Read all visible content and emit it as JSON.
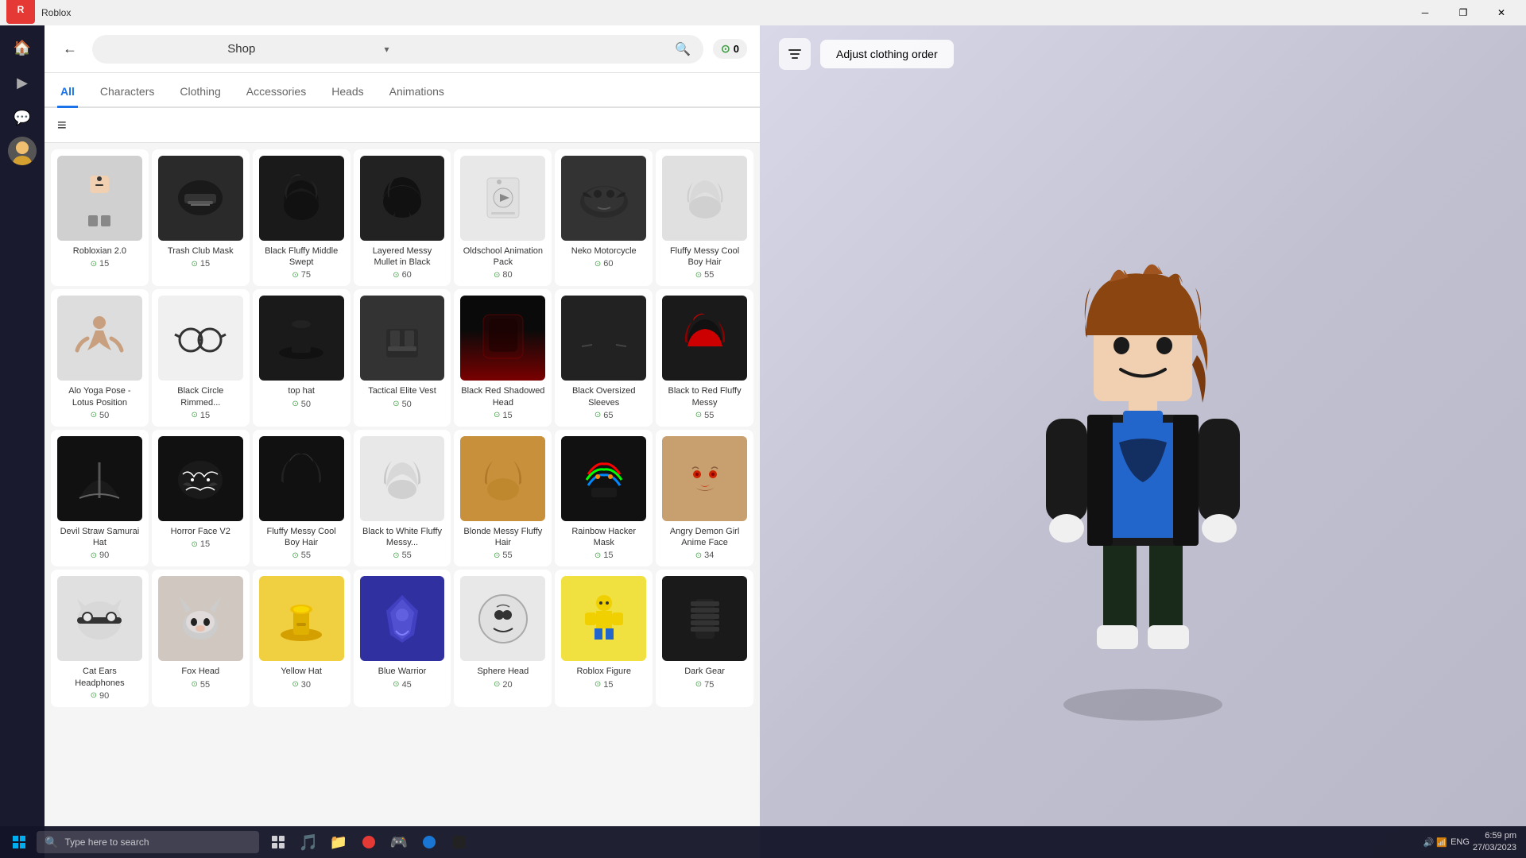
{
  "titlebar": {
    "title": "Roblox",
    "minimize": "─",
    "restore": "❐",
    "close": "✕"
  },
  "header": {
    "back_label": "←",
    "shop_title": "Shop",
    "shop_dropdown": "▾",
    "search_icon": "🔍",
    "robux_icon": "⊙",
    "robux_count": "0"
  },
  "nav_tabs": [
    {
      "label": "All",
      "active": true
    },
    {
      "label": "Characters",
      "active": false
    },
    {
      "label": "Clothing",
      "active": false
    },
    {
      "label": "Accessories",
      "active": false
    },
    {
      "label": "Heads",
      "active": false
    },
    {
      "label": "Animations",
      "active": false
    }
  ],
  "filter": {
    "icon": "≡"
  },
  "avatar_panel": {
    "filter_icon": "⚙",
    "adjust_label": "Adjust clothing order"
  },
  "items": [
    {
      "name": "Robloxian 2.0",
      "price": "15",
      "thumb_class": "thumb-robloxian",
      "emoji": "🧍"
    },
    {
      "name": "Trash Club Mask",
      "price": "15",
      "thumb_class": "thumb-mask",
      "emoji": "😷"
    },
    {
      "name": "Black Fluffy Middle Swept",
      "price": "75",
      "thumb_class": "thumb-hair-black",
      "emoji": "🖤"
    },
    {
      "name": "Layered Messy Mullet in Black",
      "price": "60",
      "thumb_class": "thumb-hair-layered",
      "emoji": "💇"
    },
    {
      "name": "Oldschool Animation Pack",
      "price": "80",
      "thumb_class": "thumb-animation",
      "emoji": "🎬"
    },
    {
      "name": "Neko Motorcycle",
      "price": "60",
      "thumb_class": "thumb-neko",
      "emoji": "🏍"
    },
    {
      "name": "Fluffy Messy Cool Boy Hair",
      "price": "55",
      "thumb_class": "thumb-fluffy-white",
      "emoji": "💈"
    },
    {
      "name": "Alo Yoga Pose - Lotus Position",
      "price": "50",
      "thumb_class": "thumb-yoga",
      "emoji": "🧘"
    },
    {
      "name": "Black Circle Rimmed...",
      "price": "15",
      "thumb_class": "thumb-glasses",
      "emoji": "👓"
    },
    {
      "name": "top hat",
      "price": "50",
      "thumb_class": "thumb-tophat",
      "emoji": "🎩"
    },
    {
      "name": "Tactical Elite Vest",
      "price": "50",
      "thumb_class": "thumb-vest",
      "emoji": "🦺"
    },
    {
      "name": "Black Red Shadowed Head",
      "price": "15",
      "thumb_class": "thumb-blackred",
      "emoji": "⬛"
    },
    {
      "name": "Black Oversized Sleeves",
      "price": "65",
      "thumb_class": "thumb-oversized",
      "emoji": "👕"
    },
    {
      "name": "Black to Red Fluffy Messy",
      "price": "55",
      "thumb_class": "thumb-blackred2",
      "emoji": "💇"
    },
    {
      "name": "Devil Straw Samurai Hat",
      "price": "90",
      "thumb_class": "thumb-devil",
      "emoji": "🎋"
    },
    {
      "name": "Horror Face V2",
      "price": "15",
      "thumb_class": "thumb-horror",
      "emoji": "😱"
    },
    {
      "name": "Fluffy Messy Cool Boy Hair",
      "price": "55",
      "thumb_class": "thumb-fluffy-black",
      "emoji": "💇"
    },
    {
      "name": "Black to White Fluffy Messy...",
      "price": "55",
      "thumb_class": "thumb-white-fluffy",
      "emoji": "💈"
    },
    {
      "name": "Blonde Messy Fluffy Hair",
      "price": "55",
      "thumb_class": "thumb-blonde",
      "emoji": "👱"
    },
    {
      "name": "Rainbow Hacker Mask",
      "price": "15",
      "thumb_class": "thumb-rainbow",
      "emoji": "🎭"
    },
    {
      "name": "Angry Demon Girl Anime Face",
      "price": "34",
      "thumb_class": "thumb-demon",
      "emoji": "😈"
    },
    {
      "name": "Cat Ears Headphones",
      "price": "90",
      "thumb_class": "thumb-cat",
      "emoji": "🐱"
    },
    {
      "name": "Fox Head",
      "price": "55",
      "thumb_class": "thumb-fox",
      "emoji": "🦊"
    },
    {
      "name": "Yellow Hat",
      "price": "30",
      "thumb_class": "thumb-yellow",
      "emoji": "🎩"
    },
    {
      "name": "Blue Warrior",
      "price": "45",
      "thumb_class": "thumb-blue",
      "emoji": "⚔"
    },
    {
      "name": "Sphere Head",
      "price": "20",
      "thumb_class": "thumb-sphere",
      "emoji": "⭕"
    },
    {
      "name": "Roblox Figure",
      "price": "15",
      "thumb_class": "thumb-figure",
      "emoji": "🧍"
    },
    {
      "name": "Dark Gear",
      "price": "75",
      "thumb_class": "thumb-dark",
      "emoji": "⚙"
    }
  ],
  "sidebar_items": [
    {
      "icon": "🏠",
      "name": "home"
    },
    {
      "icon": "▶",
      "name": "play"
    },
    {
      "icon": "💬",
      "name": "chat"
    },
    {
      "icon": "•••",
      "name": "more"
    }
  ],
  "taskbar": {
    "start_icon": "⊞",
    "search_placeholder": "Type here to search",
    "search_icon": "🔍",
    "apps": [
      {
        "icon": "🔲",
        "name": "task-view"
      },
      {
        "icon": "🎵",
        "name": "spotify"
      },
      {
        "icon": "📁",
        "name": "file-explorer"
      },
      {
        "icon": "🔴",
        "name": "app4"
      },
      {
        "icon": "🎮",
        "name": "app5"
      },
      {
        "icon": "🔵",
        "name": "app6"
      },
      {
        "icon": "⬛",
        "name": "app7"
      }
    ],
    "time": "6:59 pm",
    "date": "27/03/2023",
    "lang": "ENG"
  }
}
